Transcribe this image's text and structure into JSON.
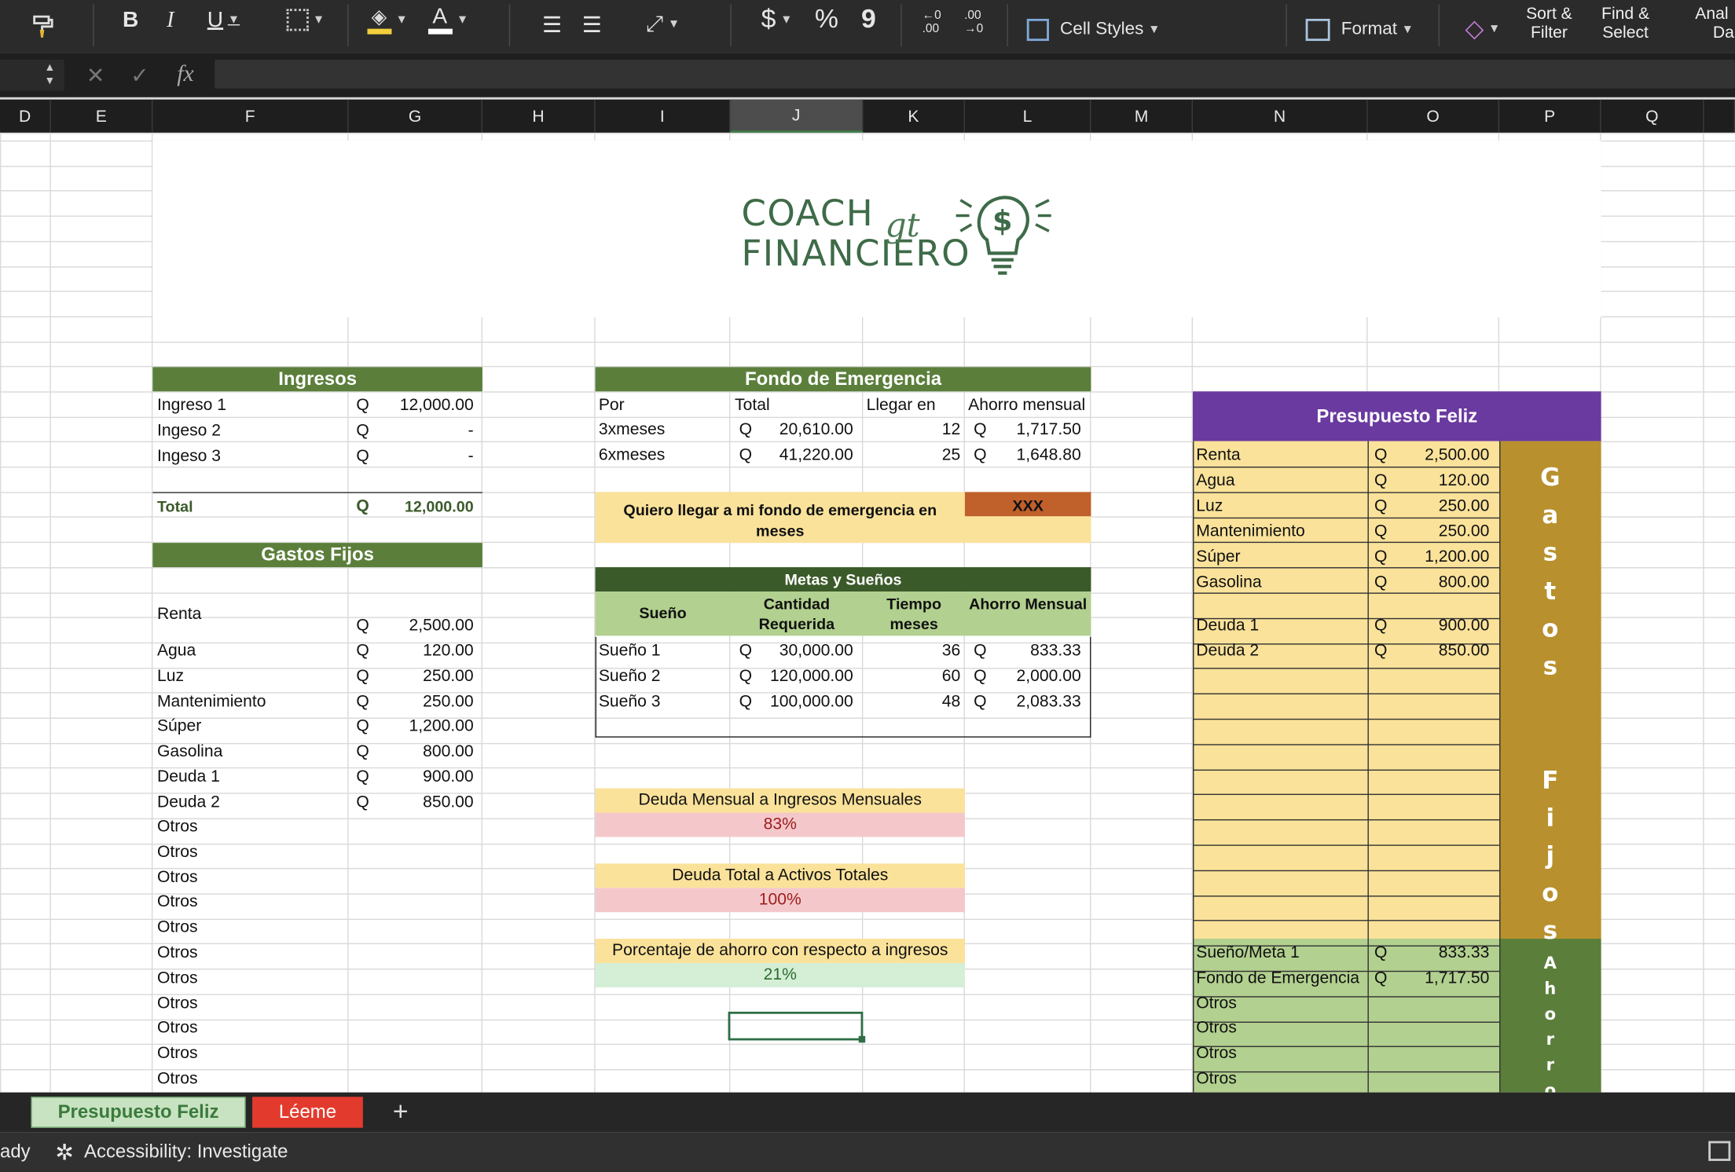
{
  "ribbon": {
    "dollar": "$",
    "percent": "%",
    "comma": "9",
    "cell_styles_label": "Cell Styles",
    "format_label": "Format",
    "sort_filter_label_1": "Sort &",
    "sort_filter_label_2": "Filter",
    "find_select_label_1": "Find &",
    "find_select_label_2": "Select",
    "analyze_label_1": "Anal",
    "analyze_label_2": "Da",
    "fx": "fx"
  },
  "columns": [
    "D",
    "E",
    "F",
    "G",
    "H",
    "I",
    "J",
    "K",
    "L",
    "M",
    "N",
    "O",
    "P",
    "Q"
  ],
  "logo": {
    "line1": "COACH",
    "line2": "FINANCIERO",
    "script": "gt",
    "symbol": "$"
  },
  "ingresos": {
    "title": "Ingresos",
    "rows": [
      {
        "label": "Ingreso 1",
        "cur": "Q",
        "value": "12,000.00"
      },
      {
        "label": "Ingeso 2",
        "cur": "Q",
        "value": "-"
      },
      {
        "label": "Ingeso 3",
        "cur": "Q",
        "value": "-"
      }
    ],
    "total_label": "Total",
    "total_cur": "Q",
    "total_value": "12,000.00"
  },
  "gastos": {
    "title": "Gastos Fijos",
    "rows": [
      {
        "label": "Renta",
        "cur": "Q",
        "value": "2,500.00"
      },
      {
        "label": "Agua",
        "cur": "Q",
        "value": "120.00"
      },
      {
        "label": "Luz",
        "cur": "Q",
        "value": "250.00"
      },
      {
        "label": "Mantenimiento",
        "cur": "Q",
        "value": "250.00"
      },
      {
        "label": "Súper",
        "cur": "Q",
        "value": "1,200.00"
      },
      {
        "label": " Gasolina",
        "cur": "Q",
        "value": "800.00"
      },
      {
        "label": "Deuda 1",
        "cur": "Q",
        "value": "900.00"
      },
      {
        "label": "Deuda 2",
        "cur": "Q",
        "value": "850.00"
      }
    ],
    "otros": [
      "Otros",
      "Otros",
      "Otros",
      "Otros",
      "Otros",
      "Otros",
      "Otros",
      "Otros",
      "Otros",
      "Otros",
      "Otros"
    ]
  },
  "fondo": {
    "title": "Fondo de Emergencia",
    "headers": [
      "Por",
      "Total",
      "Llegar en",
      "Ahorro mensual"
    ],
    "rows": [
      {
        "por": "3xmeses",
        "cur": "Q",
        "total": "20,610.00",
        "meses": "12",
        "cur2": "Q",
        "ahorro": "1,717.50"
      },
      {
        "por": "6xmeses",
        "cur": "Q",
        "total": "41,220.00",
        "meses": "25",
        "cur2": "Q",
        "ahorro": "1,648.80"
      }
    ],
    "quiero": "Quiero llegar a mi fondo de emergencia en meses",
    "xxx": "XXX"
  },
  "metas": {
    "title": "Metas y Sueños",
    "headers": [
      "Sueño",
      "Cantidad Requerida",
      "Tiempo meses",
      "Ahorro Mensual"
    ],
    "rows": [
      {
        "name": "Sueño 1",
        "cur": "Q",
        "cantidad": "30,000.00",
        "meses": "36",
        "cur2": "Q",
        "ahorro": "833.33"
      },
      {
        "name": "Sueño 2",
        "cur": "Q",
        "cantidad": "120,000.00",
        "meses": "60",
        "cur2": "Q",
        "ahorro": "2,000.00"
      },
      {
        "name": "Sueño 3",
        "cur": "Q",
        "cantidad": "100,000.00",
        "meses": "48",
        "cur2": "Q",
        "ahorro": "2,083.33"
      }
    ]
  },
  "ratios": [
    {
      "label": "Deuda Mensual a Ingresos Mensuales",
      "value": "83%"
    },
    {
      "label": "Deuda Total a Activos Totales",
      "value": "100%"
    },
    {
      "label": "Porcentaje de ahorro con respecto a ingresos",
      "value": "21%"
    }
  ],
  "presupuesto": {
    "title": "Presupuesto Feliz",
    "gastos_rows": [
      {
        "label": "Renta",
        "cur": "Q",
        "value": "2,500.00"
      },
      {
        "label": "Agua",
        "cur": "Q",
        "value": "120.00"
      },
      {
        "label": "Luz",
        "cur": "Q",
        "value": "250.00"
      },
      {
        "label": "Mantenimiento",
        "cur": "Q",
        "value": "250.00"
      },
      {
        "label": "Súper",
        "cur": "Q",
        "value": "1,200.00"
      },
      {
        "label": "Gasolina",
        "cur": "Q",
        "value": "800.00"
      },
      {
        "label": "Deuda 1",
        "cur": "Q",
        "value": "900.00"
      },
      {
        "label": "Deuda 2",
        "cur": "Q",
        "value": "850.00"
      }
    ],
    "gastos_vertical": "Gastos  Fijos",
    "ahorro_rows": [
      {
        "label": "Sueño/Meta 1",
        "cur": "Q",
        "value": "833.33"
      },
      {
        "label": "Fondo de Emergencia",
        "cur": "Q",
        "value": "1,717.50"
      },
      {
        "label": "Otros",
        "cur": "",
        "value": ""
      },
      {
        "label": "Otros",
        "cur": "",
        "value": ""
      },
      {
        "label": "Otros",
        "cur": "",
        "value": ""
      },
      {
        "label": "Otros",
        "cur": "",
        "value": ""
      }
    ],
    "ahorro_vertical": "Ahorro"
  },
  "tabs": {
    "active": "Presupuesto Feliz",
    "second": "Léeme",
    "add": "+"
  },
  "status": {
    "ready": "ady",
    "accessibility": "Accessibility: Investigate"
  },
  "colors": {
    "green_header": "#5b7f3b",
    "dark_green": "#3b5a2a",
    "light_green": "#b2d08f",
    "yellow": "#fae29a",
    "orange": "#c0602a",
    "purple": "#6a3aa0",
    "gold": "#b8912e",
    "pink": "#f4c8cb",
    "mint": "#d4efd6",
    "tab_red": "#e23b2e"
  }
}
